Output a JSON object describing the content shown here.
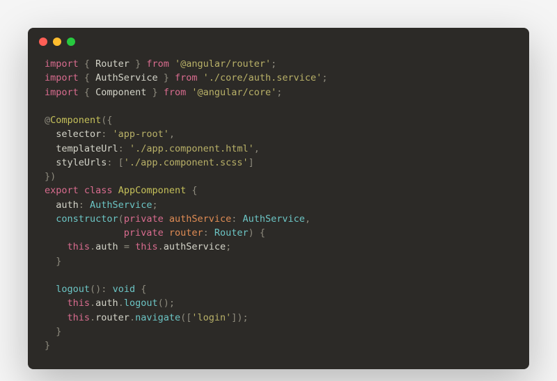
{
  "code": {
    "tokens": [
      [
        {
          "t": "import",
          "c": "kw"
        },
        {
          "t": " { ",
          "c": "punc"
        },
        {
          "t": "Router",
          "c": "prop"
        },
        {
          "t": " } ",
          "c": "punc"
        },
        {
          "t": "from",
          "c": "kw"
        },
        {
          "t": " ",
          "c": "prop"
        },
        {
          "t": "'@angular/router'",
          "c": "str"
        },
        {
          "t": ";",
          "c": "punc"
        }
      ],
      [
        {
          "t": "import",
          "c": "kw"
        },
        {
          "t": " { ",
          "c": "punc"
        },
        {
          "t": "AuthService",
          "c": "prop"
        },
        {
          "t": " } ",
          "c": "punc"
        },
        {
          "t": "from",
          "c": "kw"
        },
        {
          "t": " ",
          "c": "prop"
        },
        {
          "t": "'./core/auth.service'",
          "c": "str"
        },
        {
          "t": ";",
          "c": "punc"
        }
      ],
      [
        {
          "t": "import",
          "c": "kw"
        },
        {
          "t": " { ",
          "c": "punc"
        },
        {
          "t": "Component",
          "c": "prop"
        },
        {
          "t": " } ",
          "c": "punc"
        },
        {
          "t": "from",
          "c": "kw"
        },
        {
          "t": " ",
          "c": "prop"
        },
        {
          "t": "'@angular/core'",
          "c": "str"
        },
        {
          "t": ";",
          "c": "punc"
        }
      ],
      [],
      [
        {
          "t": "@",
          "c": "at"
        },
        {
          "t": "Component",
          "c": "decor"
        },
        {
          "t": "({",
          "c": "punc"
        }
      ],
      [
        {
          "t": "  selector",
          "c": "prop"
        },
        {
          "t": ": ",
          "c": "punc"
        },
        {
          "t": "'app-root'",
          "c": "str"
        },
        {
          "t": ",",
          "c": "punc"
        }
      ],
      [
        {
          "t": "  templateUrl",
          "c": "prop"
        },
        {
          "t": ": ",
          "c": "punc"
        },
        {
          "t": "'./app.component.html'",
          "c": "str"
        },
        {
          "t": ",",
          "c": "punc"
        }
      ],
      [
        {
          "t": "  styleUrls",
          "c": "prop"
        },
        {
          "t": ": [",
          "c": "punc"
        },
        {
          "t": "'./app.component.scss'",
          "c": "str"
        },
        {
          "t": "]",
          "c": "punc"
        }
      ],
      [
        {
          "t": "})",
          "c": "punc"
        }
      ],
      [
        {
          "t": "export",
          "c": "kw"
        },
        {
          "t": " ",
          "c": "prop"
        },
        {
          "t": "class",
          "c": "kw"
        },
        {
          "t": " ",
          "c": "prop"
        },
        {
          "t": "AppComponent",
          "c": "decor"
        },
        {
          "t": " {",
          "c": "punc"
        }
      ],
      [
        {
          "t": "  auth",
          "c": "prop"
        },
        {
          "t": ": ",
          "c": "punc"
        },
        {
          "t": "AuthService",
          "c": "type"
        },
        {
          "t": ";",
          "c": "punc"
        }
      ],
      [
        {
          "t": "  ",
          "c": "prop"
        },
        {
          "t": "constructor",
          "c": "fn"
        },
        {
          "t": "(",
          "c": "punc"
        },
        {
          "t": "private",
          "c": "kw"
        },
        {
          "t": " ",
          "c": "prop"
        },
        {
          "t": "authService",
          "c": "param"
        },
        {
          "t": ": ",
          "c": "punc"
        },
        {
          "t": "AuthService",
          "c": "type"
        },
        {
          "t": ",",
          "c": "punc"
        }
      ],
      [
        {
          "t": "              ",
          "c": "prop"
        },
        {
          "t": "private",
          "c": "kw"
        },
        {
          "t": " ",
          "c": "prop"
        },
        {
          "t": "router",
          "c": "param"
        },
        {
          "t": ": ",
          "c": "punc"
        },
        {
          "t": "Router",
          "c": "type"
        },
        {
          "t": ") {",
          "c": "punc"
        }
      ],
      [
        {
          "t": "    ",
          "c": "prop"
        },
        {
          "t": "this",
          "c": "this"
        },
        {
          "t": ".",
          "c": "punc"
        },
        {
          "t": "auth",
          "c": "prop"
        },
        {
          "t": " = ",
          "c": "punc"
        },
        {
          "t": "this",
          "c": "this"
        },
        {
          "t": ".",
          "c": "punc"
        },
        {
          "t": "authService",
          "c": "prop"
        },
        {
          "t": ";",
          "c": "punc"
        }
      ],
      [
        {
          "t": "  }",
          "c": "punc"
        }
      ],
      [],
      [
        {
          "t": "  ",
          "c": "prop"
        },
        {
          "t": "logout",
          "c": "fn"
        },
        {
          "t": "(): ",
          "c": "punc"
        },
        {
          "t": "void",
          "c": "type"
        },
        {
          "t": " {",
          "c": "punc"
        }
      ],
      [
        {
          "t": "    ",
          "c": "prop"
        },
        {
          "t": "this",
          "c": "this"
        },
        {
          "t": ".",
          "c": "punc"
        },
        {
          "t": "auth",
          "c": "prop"
        },
        {
          "t": ".",
          "c": "punc"
        },
        {
          "t": "logout",
          "c": "fn"
        },
        {
          "t": "();",
          "c": "punc"
        }
      ],
      [
        {
          "t": "    ",
          "c": "prop"
        },
        {
          "t": "this",
          "c": "this"
        },
        {
          "t": ".",
          "c": "punc"
        },
        {
          "t": "router",
          "c": "prop"
        },
        {
          "t": ".",
          "c": "punc"
        },
        {
          "t": "navigate",
          "c": "fn"
        },
        {
          "t": "([",
          "c": "punc"
        },
        {
          "t": "'login'",
          "c": "str"
        },
        {
          "t": "]);",
          "c": "punc"
        }
      ],
      [
        {
          "t": "  }",
          "c": "punc"
        }
      ],
      [
        {
          "t": "}",
          "c": "punc"
        }
      ]
    ]
  }
}
